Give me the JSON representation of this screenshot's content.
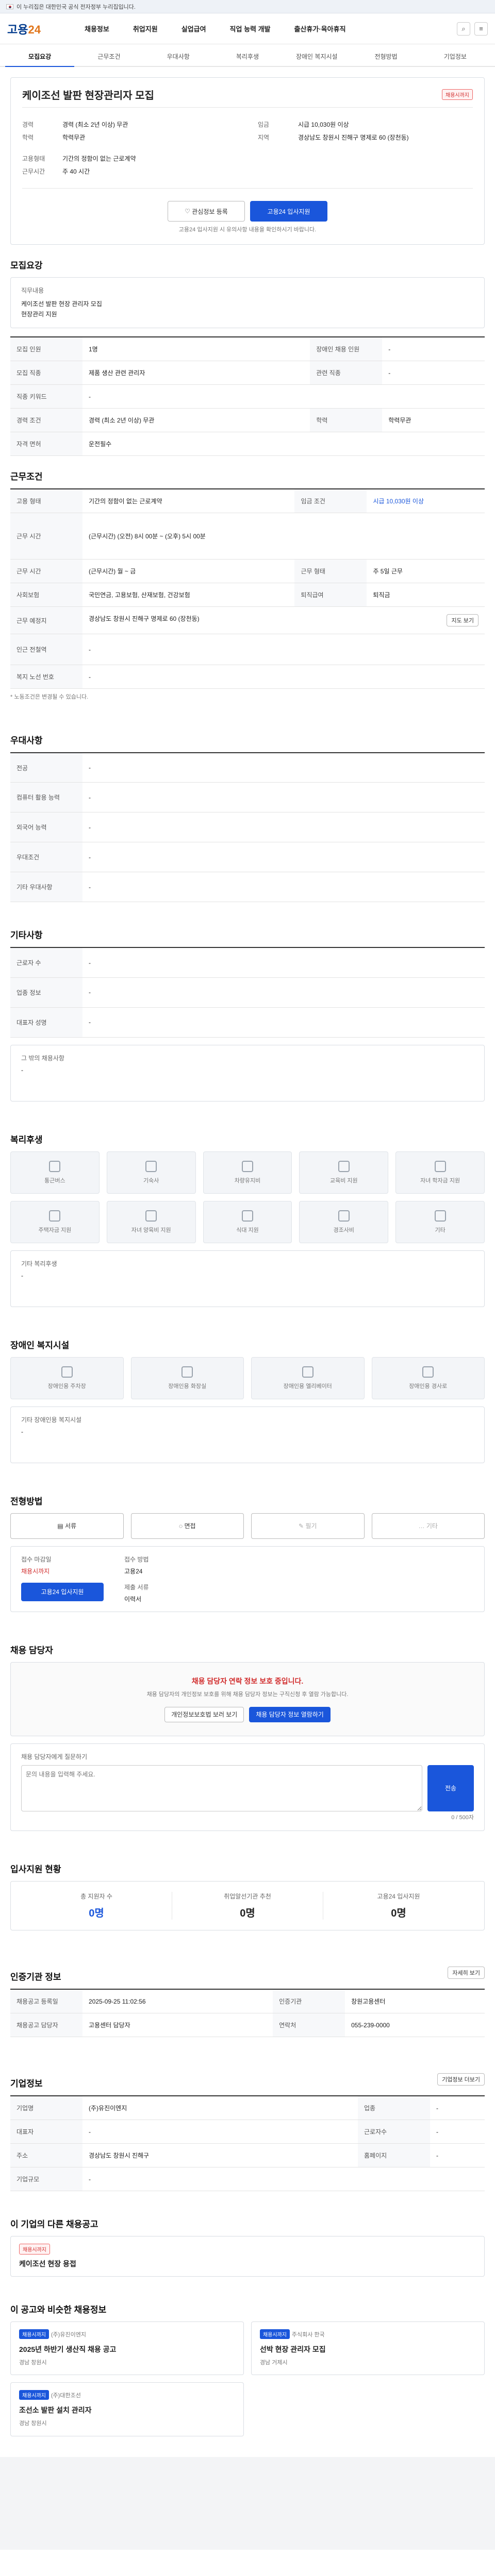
{
  "gov_banner": "이 누리집은 대한민국 공식 전자정부 누리집입니다.",
  "logo": {
    "main": "고용",
    "accent": "24"
  },
  "gnb": [
    "채용정보",
    "취업지원",
    "실업급여",
    "직업 능력 개발",
    "출산휴가·육아휴직"
  ],
  "tabs": [
    "모집요강",
    "근무조건",
    "우대사항",
    "복리후생",
    "장애인 복지시설",
    "전형방법",
    "기업정보"
  ],
  "job": {
    "badge": "채용시까지",
    "title": "케이조선 발판 현장관리자 모집",
    "company_label": "케이조선",
    "fields": [
      {
        "label": "경력",
        "value": "경력 (최소 2년 이상) 무관"
      },
      {
        "label": "학력",
        "value": "학력무관"
      },
      {
        "label": "고용형태",
        "value": "기간의 정함이 없는 근로계약"
      },
      {
        "label": "근무시간",
        "value": "주 40 시간"
      }
    ],
    "right_fields": [
      {
        "label": "임금",
        "value": "시급 10,030원 이상"
      },
      {
        "label": "지역",
        "value": "경상남도 창원시 진해구 명제로 60 (장천동)"
      }
    ],
    "scrap": "관심정보 등록",
    "apply": "고용24 입사지원",
    "notice": "고용24 입사지원 시 유의사항 내용을 확인하시기 바랍니다."
  },
  "recruit": {
    "title": "모집요강",
    "duty_label": "직무내용",
    "duty": "케이조선 발판 현장 관리자 모집\n현장관리 지원",
    "rows": [
      {
        "h": "모집 인원",
        "v": "1명",
        "h2": "장애인 채용 인원",
        "v2": "-"
      },
      {
        "h": "모집 직종",
        "v": "제품 생산 관련 관리자",
        "h2": "관련 직종",
        "v2": "-"
      },
      {
        "h": "직종 키워드",
        "v": "-",
        "h2": "",
        "v2": ""
      },
      {
        "h": "경력 조건",
        "v": "경력 (최소 2년 이상) 무관",
        "h2": "학력",
        "v2": "학력무관"
      },
      {
        "h": "자격 면허",
        "v": "운전필수",
        "h2": "",
        "v2": ""
      }
    ]
  },
  "work": {
    "title": "근무조건",
    "rows": [
      {
        "h": "고용 형태",
        "v": "기간의 정함이 없는 근로계약",
        "h2": "임금 조건",
        "v2": "시급 10,030원 이상"
      },
      {
        "h": "근무 시간",
        "v": "(근무시간) (오전) 8시 00분 ~ (오후) 5시 00분",
        "h2": "",
        "v2": ""
      },
      {
        "h": "근무 시간",
        "v": "(근무시간) 월 ~ 금",
        "h2": "근무 형태",
        "v2": "주 5일 근무"
      },
      {
        "h": "사회보험",
        "v": "국민연금, 고용보험, 산재보험, 건강보험",
        "h2": "퇴직급여",
        "v2": "퇴직금"
      },
      {
        "h": "근무 예정지",
        "v": "경상남도 창원시 진해구 명제로 60 (장천동)",
        "h2": "",
        "v2": ""
      },
      {
        "h": "인근 전철역",
        "v": "-",
        "h2": "",
        "v2": ""
      },
      {
        "h": "복지 노선 번호",
        "v": "-",
        "h2": "",
        "v2": ""
      }
    ],
    "map_btn": "지도 보기",
    "note": "* 노동조건은 변경될 수 있습니다."
  },
  "pref": {
    "title": "우대사항",
    "rows": [
      {
        "h": "전공",
        "v": "-"
      },
      {
        "h": "컴퓨터 활용 능력",
        "v": "-"
      },
      {
        "h": "외국어 능력",
        "v": "-"
      },
      {
        "h": "우대조건",
        "v": "-"
      },
      {
        "h": "기타 우대사항",
        "v": "-"
      }
    ]
  },
  "etc": {
    "title": "기타사항",
    "rows": [
      {
        "h": "근로자 수",
        "v": "-"
      },
      {
        "h": "업종 정보",
        "v": "-"
      },
      {
        "h": "대표자 성명",
        "v": "-"
      }
    ],
    "detail_label": "그 밖의 채용사항",
    "detail": "-"
  },
  "welfare": {
    "title": "복리후생",
    "items": [
      "통근버스",
      "기숙사",
      "차량유지비",
      "교육비 지원",
      "자녀 학자금 지원",
      "주택자금 지원",
      "자녀 양육비 지원",
      "식대 지원",
      "경조사비",
      "기타"
    ],
    "etc_label": "기타 복리후생",
    "etc": "-"
  },
  "disab": {
    "title": "장애인 복지시설",
    "items": [
      "장애인용 주차장",
      "장애인용 화장실",
      "장애인용 엘리베이터",
      "장애인용 경사로"
    ],
    "etc_label": "기타 장애인용 복지시설",
    "etc": "-"
  },
  "process": {
    "title": "전형방법",
    "steps": [
      "서류",
      "면접",
      "필기",
      "기타"
    ],
    "apply_label": "접수 마감일",
    "apply_value": "채용시까지",
    "docs_label": "제출 서류",
    "docs_value": "이력서",
    "method_label": "접수 방법",
    "method_value": "고용24",
    "apply_btn": "고용24 입사지원"
  },
  "consult": {
    "title": "채용 담당자",
    "alert": "채용 담당자 연락 정보 보호 중입니다.",
    "alert_sub": "채용 담당자의 개인정보 보호를 위해 채용 담당자 정보는 구직신청 후 열람 가능합니다.",
    "btn1": "개인정보보호법 보러 보기",
    "btn2": "채용 담당자 정보 열람하기",
    "ask_label": "채용 담당자에게 질문하기",
    "ask_placeholder": "문의 내용을 입력해 주세요.",
    "submit": "전송",
    "counter": "0 / 500자"
  },
  "stats": {
    "title": "입사지원 현황",
    "items": [
      {
        "label": "총 지원자 수",
        "value": "0명"
      },
      {
        "label": "취업알선기관 추천",
        "value": "0명"
      },
      {
        "label": "고용24 입사지원",
        "value": "0명"
      }
    ]
  },
  "info": {
    "title": "인증기관 정보",
    "rows": [
      {
        "h": "채용공고 등록일",
        "v": "2025-09-25 11:02:56",
        "h2": "인증기관",
        "v2": "창원고용센터"
      },
      {
        "h": "채용공고 담당자",
        "v": "고용센터 담당자",
        "h2": "연락처",
        "v2": "055-239-0000"
      }
    ],
    "btn": "자세히 보기"
  },
  "company": {
    "title": "기업정보",
    "rows": [
      {
        "h": "기업명",
        "v": "(주)유진이엔지",
        "h2": "업종",
        "v2": "-"
      },
      {
        "h": "대표자",
        "v": "-",
        "h2": "근로자수",
        "v2": "-"
      },
      {
        "h": "주소",
        "v": "경상남도 창원시 진해구",
        "h2": "홈페이지",
        "v2": "-"
      },
      {
        "h": "기업규모",
        "v": "-",
        "h2": "",
        "v2": ""
      }
    ],
    "btn": "기업정보 더보기"
  },
  "similar": {
    "title": "이 기업의 다른 채용공고",
    "items": [
      {
        "badge": "채용시까지",
        "title": "케이조선 현장 용접"
      }
    ]
  },
  "recommend": {
    "title": "이 공고와 비슷한 채용정보",
    "items": [
      {
        "badge": "채용시까지",
        "company": "(주)유진이엔지",
        "title": "2025년 하반기 생산직 채용 공고",
        "loc": "경남 창원시"
      },
      {
        "badge": "채용시까지",
        "company": "주식회사 한국",
        "title": "선박 현장 관리자 모집",
        "loc": "경남 거제시"
      },
      {
        "badge": "채용시까지",
        "company": "(주)대한조선",
        "title": "조선소 발판 설치 관리자",
        "loc": "경남 창원시"
      }
    ]
  }
}
